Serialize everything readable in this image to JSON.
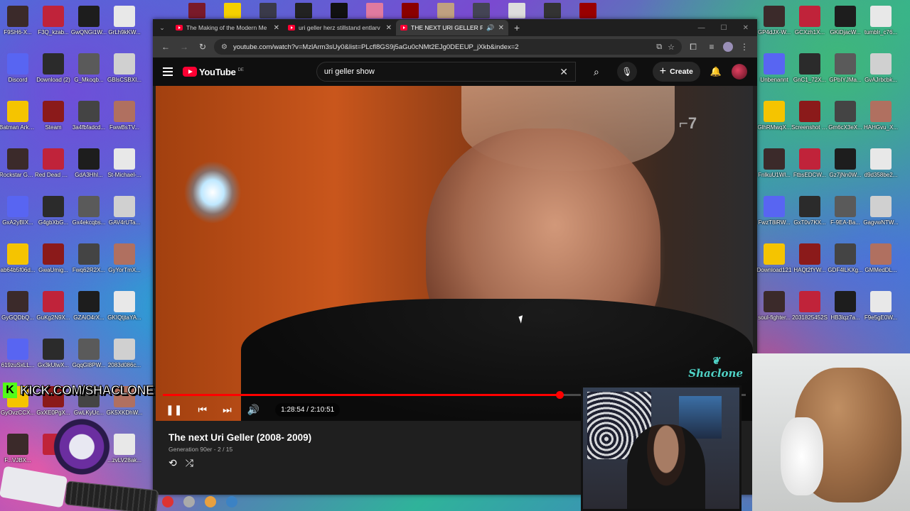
{
  "desktop": {
    "left_icons": [
      [
        "F9SH6-X...",
        "F3Q_kzab...",
        "GwQNGi1W...",
        "GrLh9kKW..."
      ],
      [
        "Discord",
        "Download (2)",
        "G_Mkoqb...",
        "GBlsCSBXI..."
      ],
      [
        "Batman Arkham As...",
        "Steam",
        "3a4fbfadcd...",
        "FwwBsTV..."
      ],
      [
        "Rockstar Games ...",
        "Red Dead Redempti...",
        "GdA3HhI...",
        "St-Michael-..."
      ],
      [
        "GxA2yBIX...",
        "G4gbXbG...",
        "Gx4ekcqbs...",
        "GAV4rUTa..."
      ],
      [
        "ab64b5f06d...",
        "GwaUmig...",
        "Fwq62R2X...",
        "GyYorTmX..."
      ],
      [
        "GyGQDbQ...",
        "GuKg2N9X...",
        "GZAiO4rX...",
        "GKIQtjtaYA..."
      ],
      [
        "619zuSxLL...",
        "Gx3kUlwX...",
        "GqqGl8PW...",
        "2083d086c..."
      ],
      [
        "GyOvzCCX...",
        "GxXE0PgX...",
        "GwLKyUc...",
        "GK5XKDhW..."
      ],
      [
        "F...VJBX...",
        "",
        "",
        "...zvLV28ak..."
      ]
    ],
    "right_icons": [
      [
        "GP4dJX-W...",
        "GCXzh1X...",
        "GKiDjacW...",
        "tumblr_c76..."
      ],
      [
        "Unbenannt",
        "GnC1_72X...",
        "GPbIYJMa...",
        "GvAJrbcbk..."
      ],
      [
        "GlhRMwqX...",
        "Screenshot 2023-06-...",
        "Gm6cX3eX...",
        "HAHGvu_X..."
      ],
      [
        "FnlkuU1Wl...",
        "FtbsEDCW...",
        "Gz7jNn0W...",
        "d9d358be2..."
      ],
      [
        "FwzT8iRW...",
        "GxT0v7KX...",
        "F-9EA-Ba...",
        "GagvwNTW..."
      ],
      [
        "Download121",
        "HAQt2fYW...",
        "GDF4lLKXg...",
        "GMMedDL..."
      ],
      [
        "soul-fighter...",
        "2031825452S",
        "HB3lqz7a...",
        "F9e5gE0W..."
      ]
    ],
    "icon_colors": [
      "#3b2a2a",
      "#c0233a",
      "#1d1d1d",
      "#e8e8e8",
      "#5865f2",
      "#2b2b2b",
      "#5a5a5a",
      "#d0d0d0",
      "#f5c400",
      "#8b1a1a",
      "#444444",
      "#b07060"
    ]
  },
  "browser": {
    "tabs": [
      {
        "title": "The Making of the Modern Me",
        "active": false,
        "audio": false
      },
      {
        "title": "uri geller herz stillstand entlarv",
        "active": false,
        "audio": false
      },
      {
        "title": "THE NEXT URI GELLER Folg",
        "active": true,
        "audio": true
      }
    ],
    "url": "youtube.com/watch?v=MzlArm3sUy0&list=PLcfl8GS9j5aGu0cNMt2EJg0DEEUP_jXkb&index=2",
    "nav": {
      "back": "←",
      "forward": "→",
      "reload": "↻"
    }
  },
  "youtube": {
    "logo_text": "YouTube",
    "region": "DE",
    "search_query": "uri geller show",
    "create_label": "Create",
    "video": {
      "title": "The next Uri Geller (2008- 2009)",
      "playlist": "Generation 90er - 2 / 15",
      "time": "1:28:54 / 2:10:51",
      "progress": 0.68
    },
    "watermark": "Shaclone"
  },
  "stream": {
    "kick_banner": "KICK.COM/SHACLONE",
    "kick_letter": "K"
  }
}
